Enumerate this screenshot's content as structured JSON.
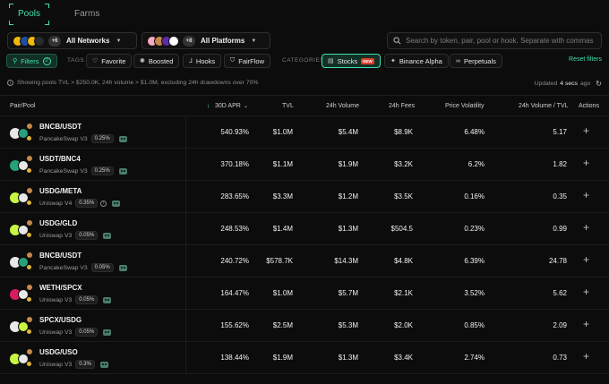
{
  "tabs": [
    {
      "label": "Pools",
      "active": true
    },
    {
      "label": "Farms",
      "active": false
    }
  ],
  "networks": {
    "label": "All Networks",
    "more": "+6",
    "coin_colors": [
      "#f0b90b",
      "#1e4ea8",
      "#f0b90b",
      "#2a2a2a"
    ]
  },
  "platforms": {
    "label": "All Platforms",
    "more": "+8",
    "coin_colors": [
      "#f6a9c3",
      "#c6894a",
      "#5a2ea6",
      "#ffffff"
    ]
  },
  "search": {
    "placeholder": "Search by token, pair, pool or hook. Separate with commas"
  },
  "filters": {
    "label": "Filters",
    "count": "2"
  },
  "tags_label": "TAGS",
  "tags": [
    {
      "label": "Favorite",
      "icon": "heart-icon",
      "glyph": "♡"
    },
    {
      "label": "Boosted",
      "icon": "rocket-icon",
      "glyph": "🔥"
    },
    {
      "label": "Hooks",
      "icon": "hook-icon",
      "glyph": "⅃"
    },
    {
      "label": "FairFlow",
      "icon": "shield-icon",
      "glyph": "⛉"
    }
  ],
  "categories_label": "CATEGORIES",
  "categories": [
    {
      "label": "Stocks",
      "icon": "stocks-icon",
      "glyph": "▤",
      "badge": "NEW",
      "active": true
    },
    {
      "label": "Binance Alpha",
      "icon": "alpha-icon",
      "glyph": "✦",
      "active": false
    },
    {
      "label": "Perpetuals",
      "icon": "perpetuals-icon",
      "glyph": "∞",
      "active": false
    }
  ],
  "reset_label": "Reset filters",
  "info": {
    "summary": "Showing pools TVL > $250.0K, 24h volume > $1.0M, excluding 24h drawdowns over 70%",
    "updated_prefix": "Updated",
    "updated_value": "4 secs",
    "updated_suffix": "ago"
  },
  "columns": {
    "pair_pool": "Pair/Pool",
    "apr": "30D APR",
    "tvl": "TVL",
    "volume": "24h Volume",
    "fees": "24h Fees",
    "volatility": "Price Volatility",
    "vol_tvl": "24h Volume / TVL",
    "actions": "Actions"
  },
  "rows": [
    {
      "pair": "BNCB/USDT",
      "protocol": "PancakeSwap V3",
      "fee": "0.25%",
      "apr": "540.93%",
      "tvl": "$1.0M",
      "volume": "$5.4M",
      "fees": "$8.9K",
      "volatility": "6.48%",
      "vol_tvl": "5.17",
      "c1": "#e8e8e8",
      "c2": "#26a17b",
      "hook": false
    },
    {
      "pair": "USDT/BNC4",
      "protocol": "PancakeSwap V3",
      "fee": "0.25%",
      "apr": "370.18%",
      "tvl": "$1.1M",
      "volume": "$1.9M",
      "fees": "$3.2K",
      "volatility": "6.2%",
      "vol_tvl": "1.82",
      "c1": "#26a17b",
      "c2": "#e8e8e8",
      "hook": false
    },
    {
      "pair": "USDG/META",
      "protocol": "Uniswap V4",
      "fee": "0.35%",
      "apr": "283.65%",
      "tvl": "$3.3M",
      "volume": "$1.2M",
      "fees": "$3.5K",
      "volatility": "0.16%",
      "vol_tvl": "0.35",
      "c1": "#c8f542",
      "c2": "#e8e8e8",
      "hook": true
    },
    {
      "pair": "USDG/GLD",
      "protocol": "Uniswap V3",
      "fee": "0.05%",
      "apr": "248.53%",
      "tvl": "$1.4M",
      "volume": "$1.3M",
      "fees": "$504.5",
      "volatility": "0.23%",
      "vol_tvl": "0.99",
      "c1": "#c8f542",
      "c2": "#e8e8e8",
      "hook": false
    },
    {
      "pair": "BNCB/USDT",
      "protocol": "PancakeSwap V3",
      "fee": "0.05%",
      "apr": "240.72%",
      "tvl": "$578.7K",
      "volume": "$14.3M",
      "fees": "$4.8K",
      "volatility": "6.39%",
      "vol_tvl": "24.78",
      "c1": "#e8e8e8",
      "c2": "#26a17b",
      "hook": false
    },
    {
      "pair": "WETH/SPCX",
      "protocol": "Uniswap V3",
      "fee": "0.05%",
      "apr": "164.47%",
      "tvl": "$1.0M",
      "volume": "$5.7M",
      "fees": "$2.1K",
      "volatility": "3.52%",
      "vol_tvl": "5.62",
      "c1": "#d81b60",
      "c2": "#e8e8e8",
      "hook": false
    },
    {
      "pair": "SPCX/USDG",
      "protocol": "Uniswap V3",
      "fee": "0.05%",
      "apr": "155.62%",
      "tvl": "$2.5M",
      "volume": "$5.3M",
      "fees": "$2.0K",
      "volatility": "0.85%",
      "vol_tvl": "2.09",
      "c1": "#e8e8e8",
      "c2": "#c8f542",
      "hook": false
    },
    {
      "pair": "USDG/USO",
      "protocol": "Uniswap V3",
      "fee": "0.3%",
      "apr": "138.44%",
      "tvl": "$1.9M",
      "volume": "$1.3M",
      "fees": "$3.4K",
      "volatility": "2.74%",
      "vol_tvl": "0.73",
      "c1": "#c8f542",
      "c2": "#e8e8e8",
      "hook": false
    }
  ],
  "colors": {
    "accent": "#3fe0b0",
    "new_badge": "#d8432f",
    "background": "#0c0c0c"
  }
}
